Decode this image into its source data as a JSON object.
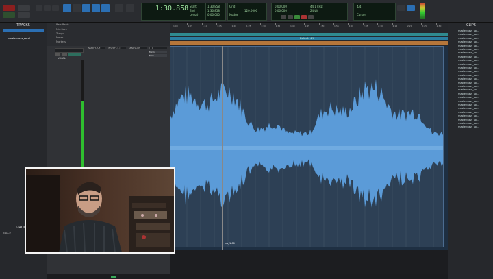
{
  "toolbar": {
    "counter_main": "1:30.858",
    "rate": "44.1 kHz",
    "bit_depth": "24-bit",
    "tempo": "120.0000",
    "meter_value": "4/4",
    "pre_roll": "0:00.000",
    "post_roll": "0:00.000",
    "start": "1:30.858",
    "end": "1:30.858",
    "length": "0:00.000",
    "grid_label": "Grid",
    "nudge_label": "Nudge",
    "cursor_label": "Cursor"
  },
  "tracks_panel": {
    "title": "TRACKS",
    "selected_track": "masterclass_vocal"
  },
  "edit_rows": {
    "markers": "Bars|Beats",
    "row2": "Min:Secs",
    "row3": "Tempo",
    "row4": "Meter",
    "row5": "Markers"
  },
  "track_header": {
    "name": "VOCAL",
    "inserts": [
      "INSERTS A-E",
      "INSERTS F-J",
      "SENDS A-E",
      "I / O"
    ],
    "io_in": "Mic 1",
    "io_out": "Main"
  },
  "default_marker": "Default: 4/4",
  "clip_label": "vo_1-00",
  "clips_panel": {
    "title": "CLIPS",
    "items": [
      "masterclass_vo...",
      "masterclass_vo...",
      "masterclass_vo...",
      "masterclass_vo...",
      "masterclass_vo...",
      "masterclass_vo...",
      "masterclass_vo...",
      "masterclass_vo...",
      "masterclass_vo...",
      "masterclass_vo...",
      "masterclass_vo...",
      "masterclass_vo...",
      "masterclass_vo...",
      "masterclass_vo...",
      "masterclass_vo...",
      "masterclass_vo...",
      "masterclass_vo...",
      "masterclass_vo...",
      "masterclass_vo...",
      "masterclass_vo...",
      "masterclass_vo...",
      "masterclass_vo...",
      "masterclass_vo...",
      "masterclass_vo...",
      "masterclass_vo...",
      "masterclass_vo...",
      "masterclass_vo..."
    ]
  },
  "groups_panel": {
    "title": "GROUPS",
    "item": "<ALL>"
  },
  "colors": {
    "waveform": "#5b9bd8",
    "waveform_bg": "#2d4055",
    "accent": "#2b8bd6",
    "marker_bar": "#2f8a8f",
    "tempo_bar": "#b5763a"
  },
  "ruler_labels": [
    "1:00",
    "1:05",
    "1:10",
    "1:15",
    "1:20",
    "1:25",
    "1:30",
    "1:35",
    "1:40",
    "1:45",
    "1:50",
    "1:55",
    "2:00",
    "2:05",
    "2:10",
    "2:15",
    "2:20",
    "2:25",
    "2:30"
  ]
}
